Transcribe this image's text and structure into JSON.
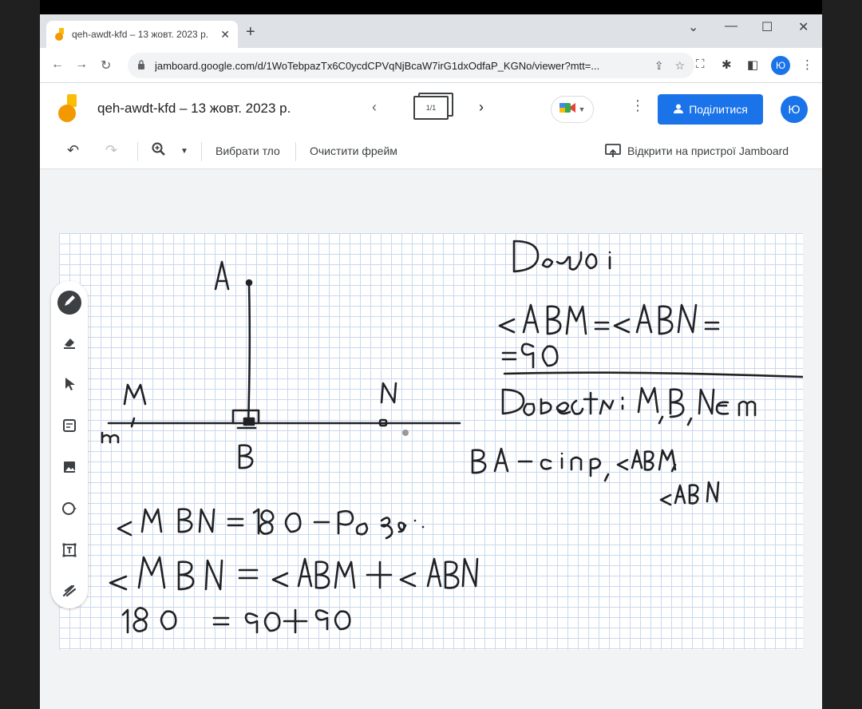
{
  "browser": {
    "tab_title": "qeh-awdt-kfd – 13 жовт. 2023 р.",
    "url": "jamboard.google.com/d/1WoTebpazTx6C0ycdCPVqNjBcaW7irG1dxOdfaP_KGNo/viewer?mtt=...",
    "profile_initial": "Ю"
  },
  "jamboard": {
    "doc_title": "qeh-awdt-kfd – 13 жовт. 2023 р.",
    "frame_indicator": "1/1",
    "share_label": "Поділитися",
    "profile_initial": "Ю"
  },
  "toolbar": {
    "set_background": "Вибрати тло",
    "clear_frame": "Очистити фрейм",
    "open_on_device": "Відкрити на пристрої Jamboard"
  },
  "colors": {
    "accent": "#1a73e8",
    "ink": "#202124",
    "grid": "#c9d9ec"
  }
}
